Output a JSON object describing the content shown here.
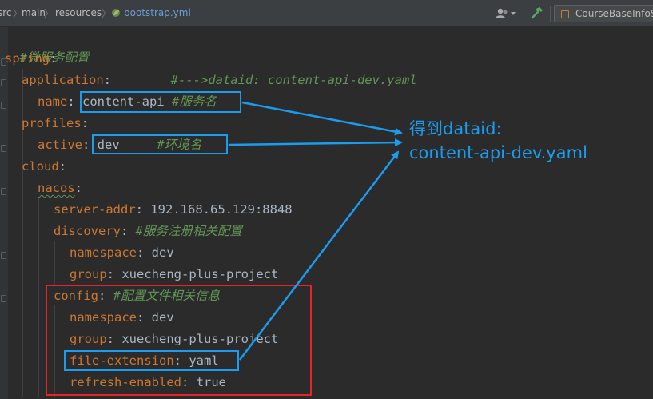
{
  "breadcrumb": {
    "items": [
      "src",
      "main",
      "resources"
    ],
    "file": "bootstrap.yml"
  },
  "toolbar": {
    "run_config": "CourseBaseInfoS"
  },
  "editor": {
    "lines": [
      {
        "comment": "#微服务配置"
      },
      {
        "key": "spring",
        "sep": ":"
      },
      {
        "key": "application",
        "sep": ":",
        "pad": "        ",
        "comment": "#--->dataid: content-api-dev.yaml"
      },
      {
        "key": "name",
        "sep": ": ",
        "value": "content-api ",
        "comment": "#服务名"
      },
      {
        "key": "profiles",
        "sep": ":"
      },
      {
        "key": "active",
        "sep": ": ",
        "value": "dev     ",
        "comment": "#环境名"
      },
      {
        "key": "cloud",
        "sep": ":"
      },
      {
        "key": "nacos",
        "sep": ":"
      },
      {
        "key": "server-addr",
        "sep": ": ",
        "value": "192.168.65.129:8848"
      },
      {
        "key": "discovery",
        "sep": ": ",
        "comment": "#服务注册相关配置"
      },
      {
        "key": "namespace",
        "sep": ": ",
        "value": "dev"
      },
      {
        "key": "group",
        "sep": ": ",
        "value": "xuecheng-plus-project"
      },
      {
        "key": "config",
        "sep": ": ",
        "comment": "#配置文件相关信息"
      },
      {
        "key": "namespace",
        "sep": ": ",
        "value": "dev"
      },
      {
        "key": "group",
        "sep": ": ",
        "value": "xuecheng-plus-project"
      },
      {
        "key": "file-extension",
        "sep": ": ",
        "value": "yaml"
      },
      {
        "key": "refresh-enabled",
        "sep": ": ",
        "value": "true"
      }
    ]
  },
  "annotation": {
    "line1": "得到dataid:",
    "line2": "content-api-dev.yaml"
  },
  "colors": {
    "key": "#cc7832",
    "comment": "#629755",
    "value": "#a9b7c6",
    "annotation_blue": "#1a9cf0",
    "annotation_red": "#e8232a"
  }
}
